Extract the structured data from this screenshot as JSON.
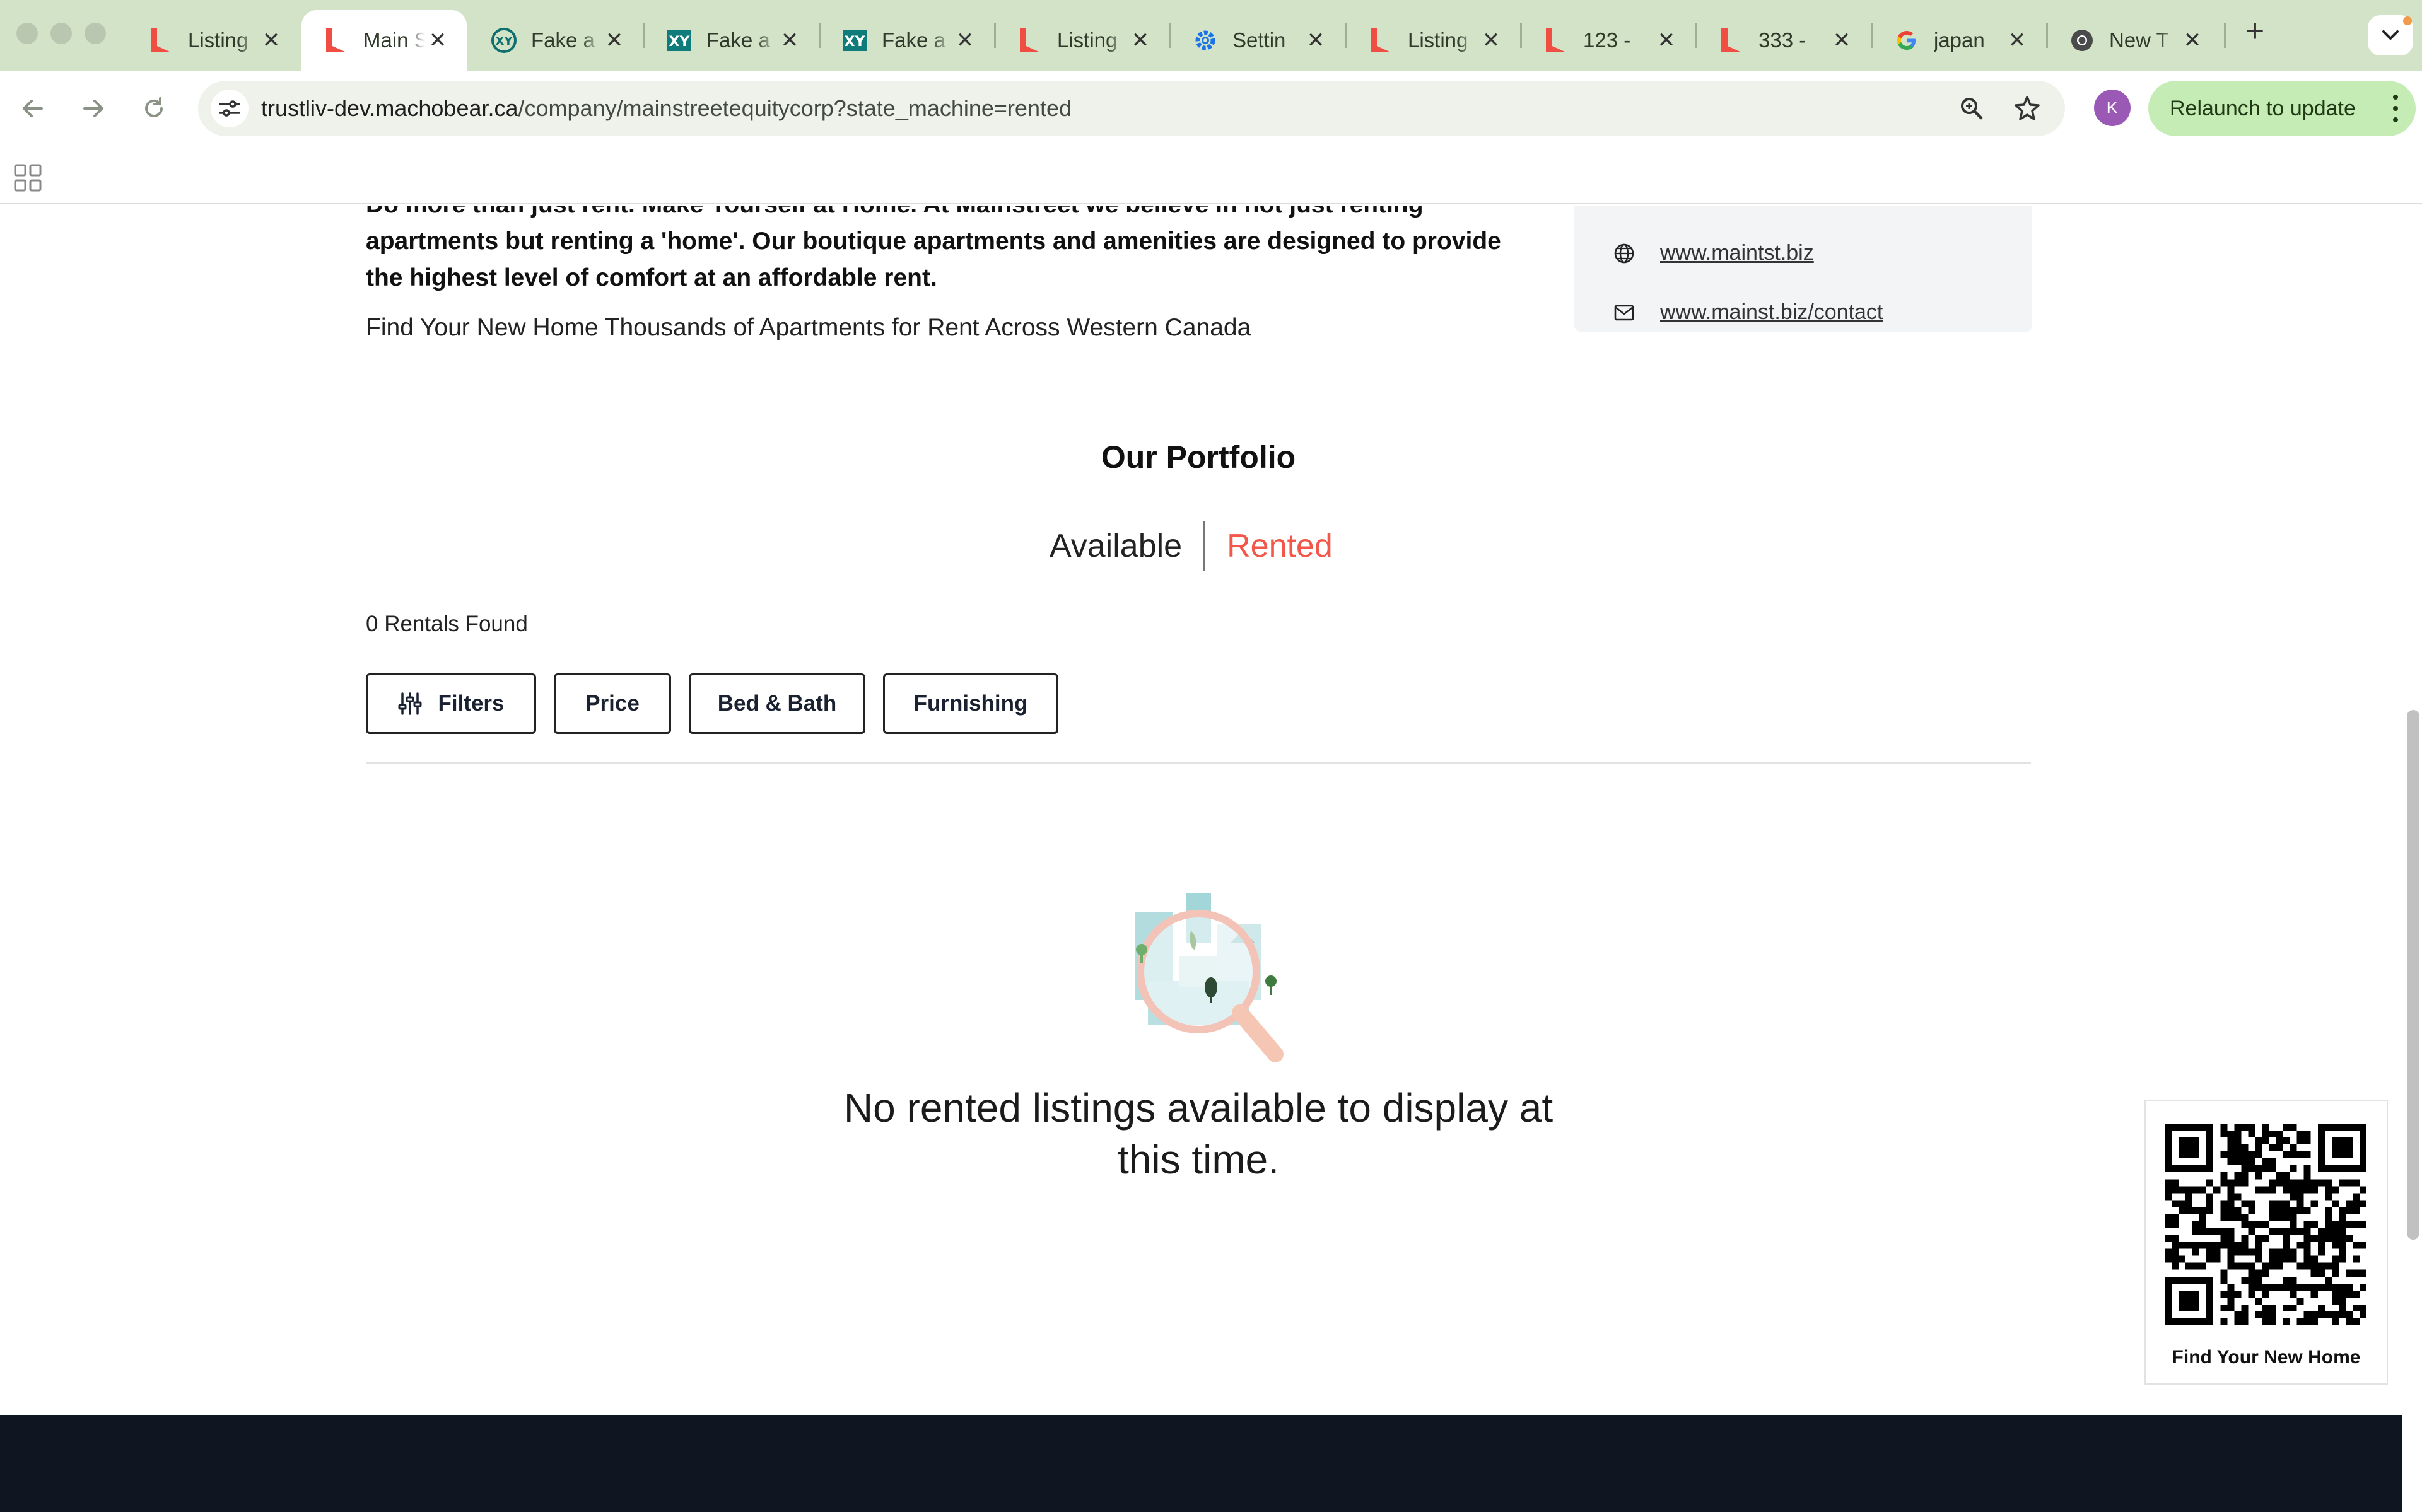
{
  "colors": {
    "tabstrip": "#d3e3c8",
    "accent_red": "#f2574a",
    "footer": "#101621",
    "relaunch_bg": "#c6ecb6",
    "avatar": "#9b59b6"
  },
  "browser": {
    "tabs": [
      {
        "title": "Listing",
        "icon": "machobear-logo-icon",
        "active": false
      },
      {
        "title": "Main S",
        "icon": "machobear-logo-icon",
        "active": true
      },
      {
        "title": "Fake a",
        "icon": "xy-circle-logo-icon",
        "active": false
      },
      {
        "title": "Fake a",
        "icon": "xy-square-logo-icon",
        "active": false
      },
      {
        "title": "Fake a",
        "icon": "xy-square-logo-icon",
        "active": false
      },
      {
        "title": "Listing",
        "icon": "machobear-logo-icon",
        "active": false
      },
      {
        "title": "Settin",
        "icon": "gear-icon",
        "active": false
      },
      {
        "title": "Listing",
        "icon": "machobear-logo-icon",
        "active": false
      },
      {
        "title": "123 -",
        "icon": "machobear-logo-icon",
        "active": false
      },
      {
        "title": "333 -",
        "icon": "machobear-logo-icon",
        "active": false
      },
      {
        "title": "japan",
        "icon": "google-logo-icon",
        "active": false
      },
      {
        "title": "New T",
        "icon": "chrome-logo-icon",
        "active": false
      }
    ],
    "address": {
      "host": "trustliv-dev.machobear.ca",
      "path": "/company/mainstreetequitycorp?state_machine=rented"
    },
    "profile_initial": "K",
    "relaunch_label": "Relaunch to update"
  },
  "company": {
    "about": "Do more than just rent. Make Yourself at Home. At Mainstreet we believe in not just renting apartments but renting a 'home'. Our boutique apartments and amenities are designed to provide the highest level of comfort at an affordable rent.",
    "tagline": "Find Your New Home Thousands of Apartments for Rent Across Western Canada",
    "website": "www.maintst.biz",
    "contact_url": "www.mainst.biz/contact"
  },
  "portfolio": {
    "title": "Our Portfolio",
    "states": [
      {
        "label": "Available",
        "active": false
      },
      {
        "label": "Rented",
        "active": true
      }
    ],
    "count_label": "0 Rentals Found",
    "filters": [
      {
        "label": "Filters",
        "icon": "sliders-icon"
      },
      {
        "label": "Price"
      },
      {
        "label": "Bed & Bath"
      },
      {
        "label": "Furnishing"
      }
    ],
    "empty_message": "No rented listings available to display at this time."
  },
  "qr": {
    "label": "Find Your New Home"
  }
}
